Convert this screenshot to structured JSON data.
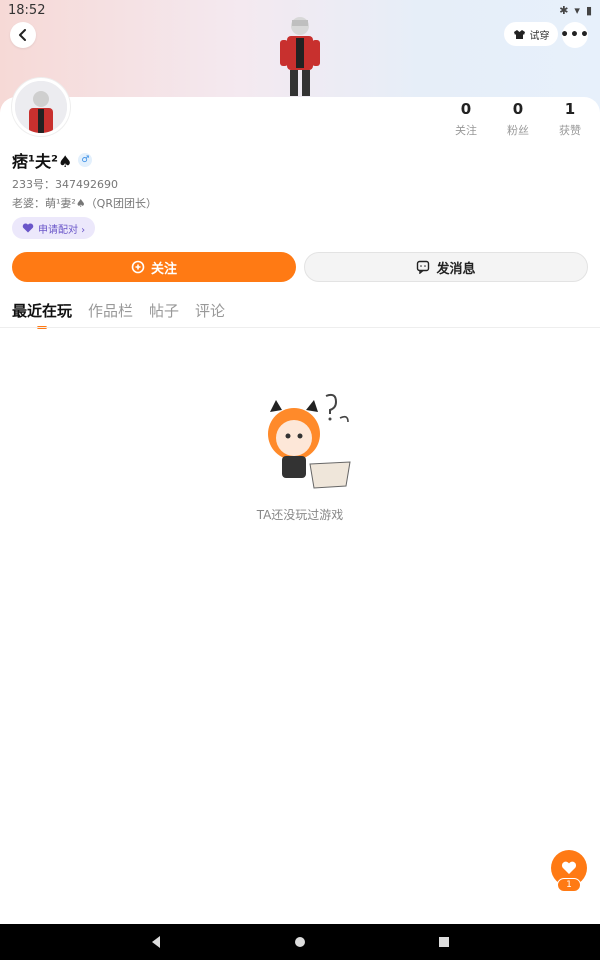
{
  "status_bar": {
    "time": "18:52"
  },
  "header": {
    "tryon_label": "试穿",
    "more_label": "•••"
  },
  "profile": {
    "username": "痞¹夫²♠",
    "gender_symbol": "♂",
    "uid_text": "233号：347492690",
    "spouse_text": "老婆：萌¹妻²♠（QR团团长）",
    "pair_label": "申请配对 ›"
  },
  "stats": [
    {
      "value": "0",
      "label": "关注"
    },
    {
      "value": "0",
      "label": "粉丝"
    },
    {
      "value": "1",
      "label": "获赞"
    }
  ],
  "actions": {
    "follow_label": "关注",
    "message_label": "发消息"
  },
  "tabs": [
    {
      "label": "最近在玩",
      "active": true
    },
    {
      "label": "作品栏",
      "active": false
    },
    {
      "label": "帖子",
      "active": false
    },
    {
      "label": "评论",
      "active": false
    }
  ],
  "empty_state": {
    "text": "TA还没玩过游戏"
  },
  "fab": {
    "badge": "1"
  },
  "colors": {
    "accent": "#ff7a14",
    "pair_bg": "#ece8fb",
    "pair_text": "#6a56c9"
  }
}
